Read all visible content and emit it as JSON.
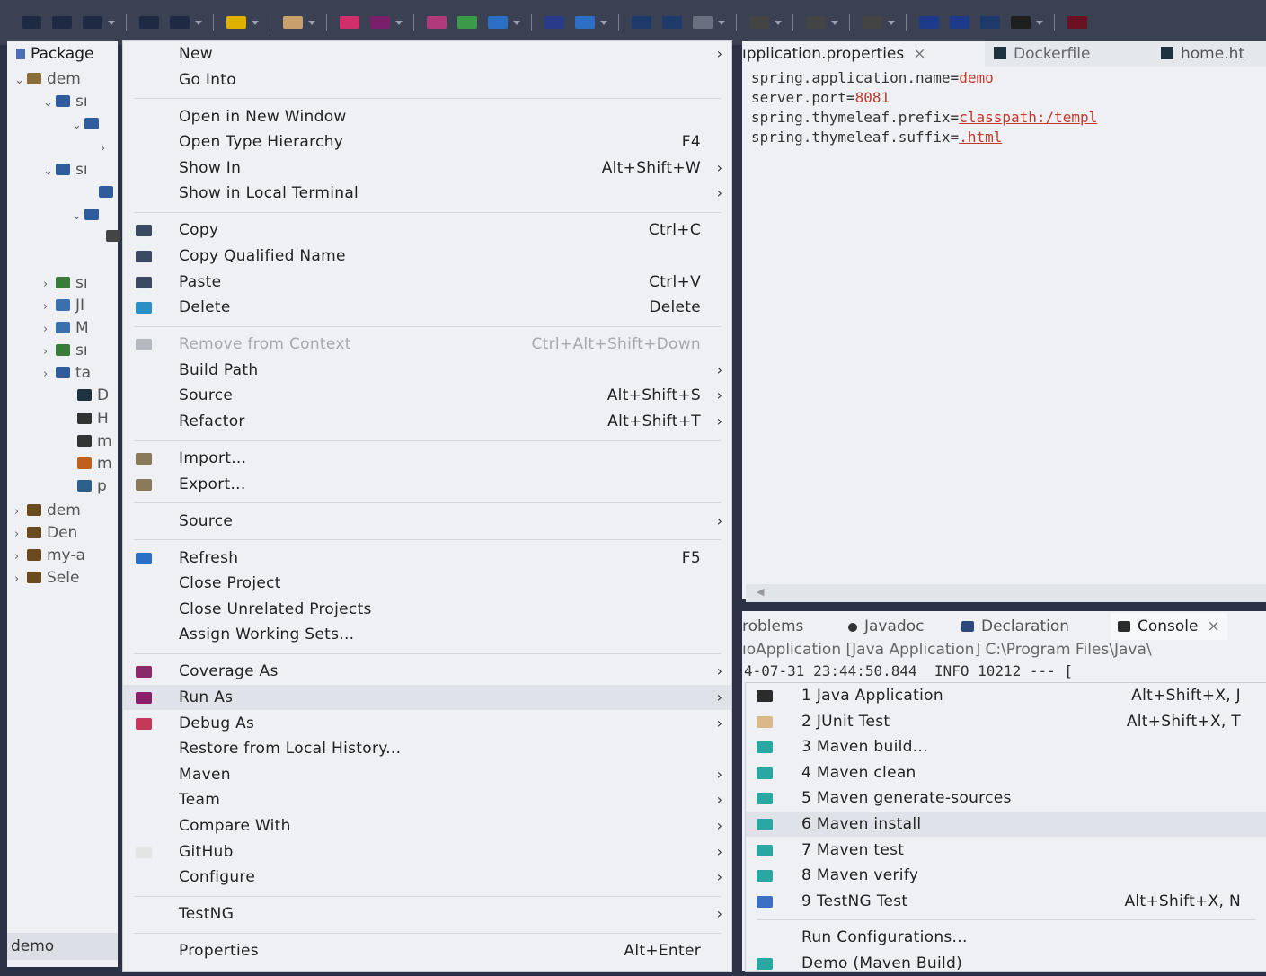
{
  "toolbar": {
    "icons": [
      "new-icon",
      "save-icon",
      "save-all-icon",
      "undo-icon",
      "redo-icon",
      "terminal-icon",
      "build-icon",
      "debug-icon",
      "run-icon",
      "external-tools-icon",
      "coverage-icon",
      "new-java-project-icon",
      "new-class-icon",
      "open-type-icon",
      "search-icon",
      "open-task-icon",
      "annotation-icon",
      "paragraph-icon",
      "toggle-icon",
      "pin-icon",
      "back-icon",
      "forward-icon",
      "prev-edit-icon",
      "next-edit-icon",
      "perspective-icon"
    ]
  },
  "package_explorer": {
    "title": "Package",
    "rows": [
      {
        "arrow": "⌄",
        "label": "dem",
        "icon": "project-icon",
        "color": "#8a6d3b"
      },
      {
        "arrow": "⌄",
        "label": "sı",
        "icon": "source-folder-icon",
        "color": "#2f5d9c"
      },
      {
        "arrow": "⌄",
        "label": "",
        "icon": "package-icon",
        "color": "#2f5d9c"
      },
      {
        "arrow": "›",
        "label": "",
        "icon": "",
        "color": "#2f5d9c"
      },
      {
        "arrow": "⌄",
        "label": "sı",
        "icon": "source-folder-icon",
        "color": "#2f5d9c"
      },
      {
        "arrow": "",
        "label": "",
        "icon": "folder-icon",
        "color": "#2f5d9c"
      },
      {
        "arrow": "⌄",
        "label": "",
        "icon": "folder-icon",
        "color": "#2f5d9c"
      },
      {
        "arrow": "",
        "label": "",
        "icon": "file-icon",
        "color": "#444"
      },
      {
        "arrow": "›",
        "label": "sı",
        "icon": "source-folder-icon",
        "color": "#3a7a3a"
      },
      {
        "arrow": "›",
        "label": "JI",
        "icon": "library-icon",
        "color": "#3a6fb0"
      },
      {
        "arrow": "›",
        "label": "M",
        "icon": "library-icon",
        "color": "#3a6fb0"
      },
      {
        "arrow": "›",
        "label": "sı",
        "icon": "source-folder-icon",
        "color": "#3a7a3a"
      },
      {
        "arrow": "›",
        "label": "ta",
        "icon": "folder-icon",
        "color": "#2f5d9c"
      },
      {
        "arrow": "",
        "label": "D",
        "icon": "docker-icon",
        "color": "#1e3240"
      },
      {
        "arrow": "",
        "label": "H",
        "icon": "html-icon",
        "color": "#333"
      },
      {
        "arrow": "",
        "label": "m",
        "icon": "file-icon",
        "color": "#333"
      },
      {
        "arrow": "",
        "label": "m",
        "icon": "file-icon",
        "color": "#c0601a"
      },
      {
        "arrow": "",
        "label": "p",
        "icon": "xml-icon",
        "color": "#2c5f8a"
      },
      {
        "arrow": "›",
        "label": "dem",
        "icon": "project-icon",
        "color": "#6b4a1f"
      },
      {
        "arrow": "›",
        "label": "Den",
        "icon": "project-icon",
        "color": "#6b4a1f"
      },
      {
        "arrow": "›",
        "label": "my-a",
        "icon": "project-icon",
        "color": "#6b4a1f"
      },
      {
        "arrow": "›",
        "label": "Sele",
        "icon": "project-icon",
        "color": "#6b4a1f"
      }
    ],
    "footer": "demo"
  },
  "editor": {
    "tabs": [
      {
        "label": "ıpplication.properties",
        "close": "×",
        "active": true
      },
      {
        "label": "Dockerfile",
        "active": false
      },
      {
        "label": "home.ht",
        "active": false
      }
    ],
    "lines": [
      {
        "key": "spring.application.name=",
        "value": "demo",
        "style": "v"
      },
      {
        "key": "server.port=",
        "value": "8081",
        "style": "v"
      },
      {
        "key": "spring.thymeleaf.prefix=",
        "value": "classpath:/templ",
        "style": "u"
      },
      {
        "key": "spring.thymeleaf.suffix=",
        "value": ".html",
        "style": "u"
      }
    ]
  },
  "console": {
    "tabs": [
      {
        "label": "roblems",
        "icon": "",
        "active": false
      },
      {
        "label": "Javadoc",
        "icon": "javadoc-icon",
        "active": false
      },
      {
        "label": "Declaration",
        "icon": "declaration-icon",
        "active": false
      },
      {
        "label": "Console",
        "icon": "console-icon",
        "active": true,
        "close": "×"
      }
    ],
    "description": "ıoApplication [Java Application] C:\\Program Files\\Java\\",
    "log": "4-07-31 23:44:50.844  INFO 10212 --- ["
  },
  "context_menu": {
    "items": [
      {
        "label": "New",
        "shortcut": "",
        "submenu": true
      },
      {
        "label": "Go Into",
        "shortcut": ""
      },
      {
        "sep": true
      },
      {
        "label": "Open in New Window",
        "shortcut": ""
      },
      {
        "label": "Open Type Hierarchy",
        "shortcut": "F4"
      },
      {
        "label": "Show In",
        "shortcut": "Alt+Shift+W",
        "submenu": true
      },
      {
        "label": "Show in Local Terminal",
        "shortcut": "",
        "submenu": true
      },
      {
        "sep": true
      },
      {
        "label": "Copy",
        "shortcut": "Ctrl+C",
        "icon": "copy-icon",
        "color": "#3b4a63"
      },
      {
        "label": "Copy Qualified Name",
        "shortcut": "",
        "icon": "copy-qualified-icon",
        "color": "#3b4a63"
      },
      {
        "label": "Paste",
        "shortcut": "Ctrl+V",
        "icon": "paste-icon",
        "color": "#3b4a63"
      },
      {
        "label": "Delete",
        "shortcut": "Delete",
        "icon": "delete-icon",
        "color": "#2a8fc4"
      },
      {
        "sep": true
      },
      {
        "label": "Remove from Context",
        "shortcut": "Ctrl+Alt+Shift+Down",
        "disabled": true,
        "icon": "remove-context-icon",
        "color": "#b5b8be"
      },
      {
        "label": "Build Path",
        "shortcut": "",
        "submenu": true
      },
      {
        "label": "Source",
        "shortcut": "Alt+Shift+S",
        "submenu": true
      },
      {
        "label": "Refactor",
        "shortcut": "Alt+Shift+T",
        "submenu": true
      },
      {
        "sep": true
      },
      {
        "label": "Import...",
        "shortcut": "",
        "icon": "import-icon",
        "color": "#8a7a5a"
      },
      {
        "label": "Export...",
        "shortcut": "",
        "icon": "export-icon",
        "color": "#8a7a5a"
      },
      {
        "sep": true
      },
      {
        "label": "Source",
        "shortcut": "",
        "submenu": true
      },
      {
        "sep": true
      },
      {
        "label": "Refresh",
        "shortcut": "F5",
        "icon": "refresh-icon",
        "color": "#2a6fc4"
      },
      {
        "label": "Close Project",
        "shortcut": ""
      },
      {
        "label": "Close Unrelated Projects",
        "shortcut": ""
      },
      {
        "label": "Assign Working Sets...",
        "shortcut": ""
      },
      {
        "sep": true
      },
      {
        "label": "Coverage As",
        "shortcut": "",
        "submenu": true,
        "icon": "coverage-icon",
        "color": "#8a2a6a"
      },
      {
        "label": "Run As",
        "shortcut": "",
        "submenu": true,
        "icon": "run-icon",
        "color": "#8a1f6a",
        "highlight": true
      },
      {
        "label": "Debug As",
        "shortcut": "",
        "submenu": true,
        "icon": "debug-icon",
        "color": "#c4385a"
      },
      {
        "label": "Restore from Local History...",
        "shortcut": ""
      },
      {
        "label": "Maven",
        "shortcut": "",
        "submenu": true
      },
      {
        "label": "Team",
        "shortcut": "",
        "submenu": true
      },
      {
        "label": "Compare With",
        "shortcut": "",
        "submenu": true
      },
      {
        "label": "GitHub",
        "shortcut": "",
        "submenu": true,
        "icon": "github-icon",
        "color": "#e4e4e4"
      },
      {
        "label": "Configure",
        "shortcut": "",
        "submenu": true
      },
      {
        "sep": true
      },
      {
        "label": "TestNG",
        "shortcut": "",
        "submenu": true
      },
      {
        "sep": true
      },
      {
        "label": "Properties",
        "shortcut": "Alt+Enter"
      }
    ]
  },
  "run_as_menu": {
    "items": [
      {
        "label": "1 Java Application",
        "shortcut": "Alt+Shift+X, J",
        "icon": "java-app-icon",
        "color": "#2b2b2b"
      },
      {
        "label": "2 JUnit Test",
        "shortcut": "Alt+Shift+X, T",
        "icon": "junit-icon",
        "color": "#d9b98a"
      },
      {
        "label": "3 Maven build...",
        "shortcut": "",
        "icon": "maven-icon",
        "color": "#2aa7a0"
      },
      {
        "label": "4 Maven clean",
        "shortcut": "",
        "icon": "maven-icon",
        "color": "#2aa7a0"
      },
      {
        "label": "5 Maven generate-sources",
        "shortcut": "",
        "icon": "maven-icon",
        "color": "#2aa7a0"
      },
      {
        "label": "6 Maven install",
        "shortcut": "",
        "icon": "maven-icon",
        "color": "#2aa7a0",
        "highlight": true
      },
      {
        "label": "7 Maven test",
        "shortcut": "",
        "icon": "maven-icon",
        "color": "#2aa7a0"
      },
      {
        "label": "8 Maven verify",
        "shortcut": "",
        "icon": "maven-icon",
        "color": "#2aa7a0"
      },
      {
        "label": "9 TestNG Test",
        "shortcut": "Alt+Shift+X, N",
        "icon": "testng-icon",
        "color": "#3a6fc4"
      },
      {
        "sep": true
      },
      {
        "label": "Run Configurations...",
        "shortcut": ""
      },
      {
        "label": "Demo (Maven Build)",
        "shortcut": "",
        "icon": "maven-icon",
        "color": "#2aa7a0"
      }
    ]
  }
}
